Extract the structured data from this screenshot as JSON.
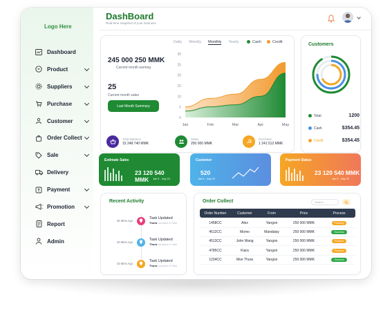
{
  "brand": {
    "logo": "Logo Here",
    "title": "DashBoard",
    "subtitle": "Real-time snapshot of your business"
  },
  "sidebar": {
    "items": [
      {
        "label": "Dashboard",
        "icon": "dashboard-icon",
        "has_chevron": false
      },
      {
        "label": "Product",
        "icon": "box-icon",
        "has_chevron": true
      },
      {
        "label": "Suppliers",
        "icon": "gear-icon",
        "has_chevron": true
      },
      {
        "label": "Purchase",
        "icon": "cart-icon",
        "has_chevron": true
      },
      {
        "label": "Customer",
        "icon": "users-icon",
        "has_chevron": true
      },
      {
        "label": "Order Collect",
        "icon": "bag-icon",
        "has_chevron": true
      },
      {
        "label": "Sale",
        "icon": "tag-icon",
        "has_chevron": true
      },
      {
        "label": "Delivery",
        "icon": "truck-icon",
        "has_chevron": false
      },
      {
        "label": "Payment",
        "icon": "wallet-icon",
        "has_chevron": true
      },
      {
        "label": "Promotion",
        "icon": "megaphone-icon",
        "has_chevron": true
      },
      {
        "label": "Report",
        "icon": "document-icon",
        "has_chevron": false
      },
      {
        "label": "Admin",
        "icon": "user-icon",
        "has_chevron": false
      }
    ]
  },
  "overview": {
    "earning_value": "245 000 250 MMK",
    "earning_label": "Current month earning",
    "sales_value": "25",
    "sales_label": "Current month sales",
    "summary_button": "Last Month Summary",
    "tabs": [
      "Daily",
      "Weekly",
      "Monthly",
      "Yearly"
    ],
    "active_tab": "Monthly",
    "legend": [
      {
        "label": "Cash",
        "color": "#1f8a33"
      },
      {
        "label": "Credit",
        "color": "#f29a2e"
      }
    ],
    "total_balance_label": "Total Balance",
    "total_balance_value": "15 248 740 MMK",
    "sales_mini_label": "Sales",
    "sales_mini_value": "250 000 MMK",
    "purchase_label": "Purchase",
    "purchase_value": "1 241 512 MMK"
  },
  "chart_data": {
    "type": "area",
    "x": [
      "Jan",
      "Feb",
      "Mar",
      "Apr",
      "May"
    ],
    "ylim": [
      0,
      30
    ],
    "yticks": [
      0,
      5,
      10,
      15,
      20,
      25,
      30
    ],
    "series": [
      {
        "name": "Cash",
        "color": "#1f8a33",
        "values": [
          3,
          5,
          6,
          10,
          21
        ]
      },
      {
        "name": "Credit",
        "color": "#f29a2e",
        "values": [
          5,
          9,
          11,
          18,
          26
        ]
      }
    ]
  },
  "customers": {
    "title": "Customers",
    "total_label": "Total",
    "total_value": "1200",
    "cash_label": "Cash",
    "cash_value": "$354.45",
    "credit_label": "Credit",
    "credit_value": "$354.45",
    "colors": {
      "total": "#1f8a33",
      "cash": "#4a90e2",
      "credit": "#f5a623"
    }
  },
  "kpis": {
    "estimate": {
      "title": "Estimate Sales",
      "value": "23 120 540 MMK",
      "dates": "Jan 5 - July 23"
    },
    "customer": {
      "title": "Customer",
      "value": "520",
      "dates": "Jan 5 - July 23"
    },
    "payment": {
      "title": "Payment Status",
      "value": "23 120 540 MMK",
      "dates": "Jan 5 - July 23"
    }
  },
  "recent_activity": {
    "title": "Recent Activity",
    "items": [
      {
        "time": "45 Mins Ago",
        "title": "Task Updated",
        "who": "Thura",
        "action": "Updated A Task",
        "color": "#e8407a"
      },
      {
        "time": "40 Mins Ago",
        "title": "Task Updated",
        "who": "Thura",
        "action": "Updated A Task",
        "color": "#4fb3e8"
      },
      {
        "time": "43 Mins Ago",
        "title": "Task Updated",
        "who": "Thura",
        "action": "Updated A Task",
        "color": "#f5a623"
      }
    ]
  },
  "order_collect": {
    "title": "Order Collect",
    "search_placeholder": "Search",
    "headers": [
      "Order Number",
      "Customer",
      "From",
      "Price",
      "Process"
    ],
    "rows": [
      {
        "order": "1458CC",
        "customer": "Alex",
        "from": "Yangon",
        "price": "250 000 MMK",
        "status": "Pending",
        "status_color": "#f5a623"
      },
      {
        "order": "4512CC",
        "customer": "Momo",
        "from": "Mandalay",
        "price": "250 000 MMK",
        "status": "Success",
        "status_color": "#2aa845"
      },
      {
        "order": "4513CC",
        "customer": "John Wang",
        "from": "Yangon",
        "price": "250 000 MMK",
        "status": "Process",
        "status_color": "#f5a623"
      },
      {
        "order": "4785CC",
        "customer": "Kiara",
        "from": "Yangon",
        "price": "250 000 MMK",
        "status": "Process",
        "status_color": "#f5a623"
      },
      {
        "order": "1234CC",
        "customer": "Moe Thura",
        "from": "Yangon",
        "price": "250 000 MMK",
        "status": "Success",
        "status_color": "#2aa845"
      }
    ]
  }
}
